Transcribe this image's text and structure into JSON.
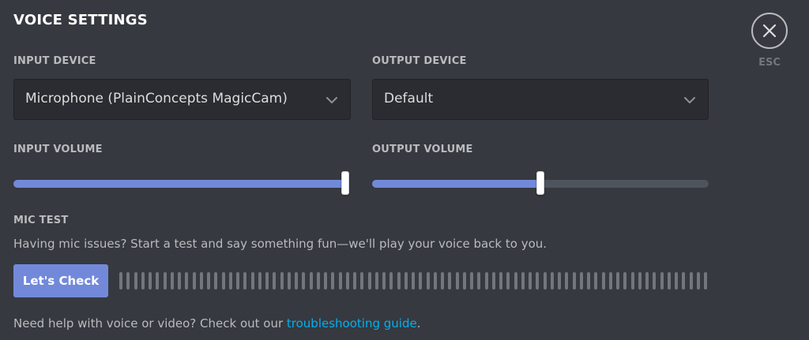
{
  "title": "VOICE SETTINGS",
  "close": {
    "esc_label": "ESC",
    "icon": "close-icon"
  },
  "input_device": {
    "label": "INPUT DEVICE",
    "value": "Microphone (PlainConcepts MagicCam)"
  },
  "output_device": {
    "label": "OUTPUT DEVICE",
    "value": "Default"
  },
  "input_volume": {
    "label": "INPUT VOLUME",
    "level_fraction": 1.0
  },
  "output_volume": {
    "label": "OUTPUT VOLUME",
    "level_fraction": 0.5
  },
  "mic_test": {
    "label": "MIC TEST",
    "description": "Having mic issues? Start a test and say something fun—we'll play your voice back to you.",
    "button_label": "Let's Check",
    "meter_level_fraction": 0
  },
  "help": {
    "text": "Need help with voice or video? Check out our ",
    "link_text": "troubleshooting guide",
    "suffix": "."
  },
  "colors": {
    "background": "#36393f",
    "accent": "#7289da",
    "link": "#00b0f4"
  }
}
